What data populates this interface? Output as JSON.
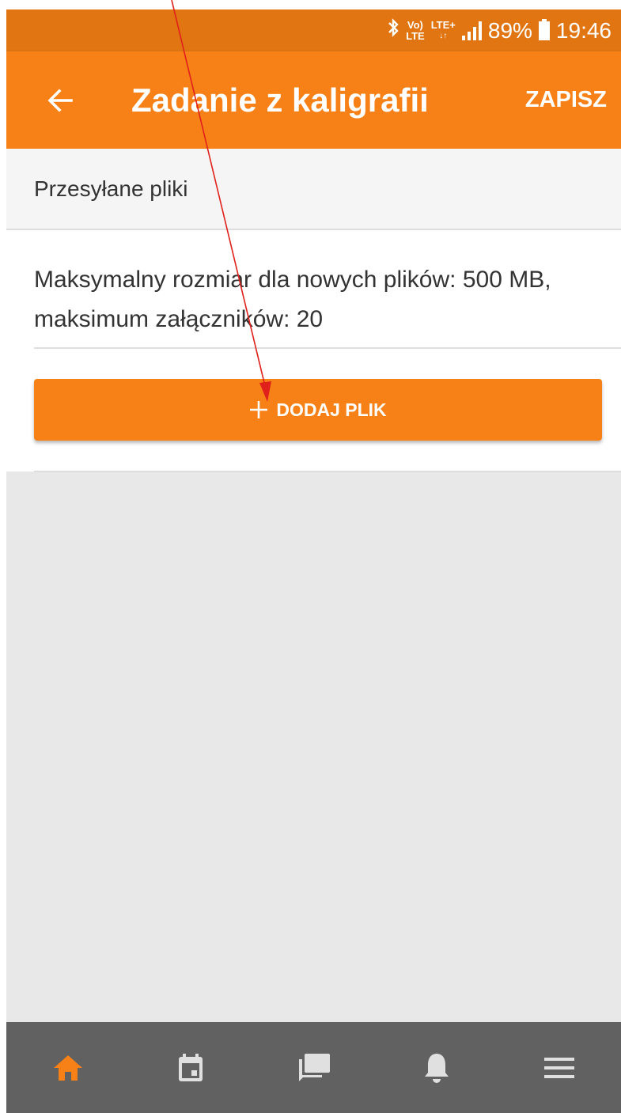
{
  "status_bar": {
    "network_top": "Vo)",
    "network_bottom": "LTE",
    "data_type": "LTE+",
    "battery": "89%",
    "time": "19:46",
    "icons": [
      "bluetooth-icon",
      "signal-icon",
      "battery-icon"
    ]
  },
  "app_bar": {
    "title": "Zadanie z kaligrafii",
    "save_label": "ZAPISZ",
    "back_icon": "arrow-left-icon"
  },
  "section": {
    "header": "Przesyłane pliki",
    "info": "Maksymalny rozmiar dla nowych plików: 500 MB, maksimum załączników: 20",
    "add_button_label": "DODAJ PLIK",
    "add_button_icon": "plus-icon"
  },
  "bottom_nav": {
    "items": [
      {
        "icon": "home-icon",
        "active": true
      },
      {
        "icon": "calendar-icon",
        "active": false
      },
      {
        "icon": "messages-icon",
        "active": false
      },
      {
        "icon": "bell-icon",
        "active": false
      },
      {
        "icon": "menu-icon",
        "active": false
      }
    ]
  },
  "colors": {
    "accent": "#f78117",
    "status_bar": "#e07512",
    "bottom_nav": "#616161",
    "background": "#e8e8e8",
    "annotation": "#e0201a"
  }
}
